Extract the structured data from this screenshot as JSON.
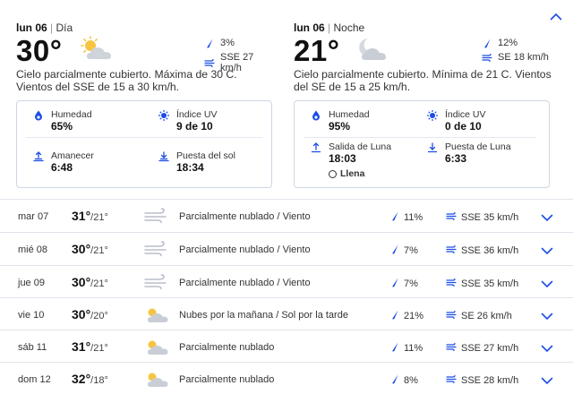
{
  "day": {
    "date": "lun 06",
    "period": "Día",
    "temp": "30°",
    "precip": "3%",
    "wind": "SSE 27 km/h",
    "description": "Cielo parcialmente cubierto. Máxima de 30 C. Vientos del SSE de 15 a 30 km/h.",
    "details": {
      "humidity_label": "Humedad",
      "humidity": "65%",
      "uv_label": "Índice UV",
      "uv": "9 de 10",
      "sunrise_label": "Amanecer",
      "sunrise": "6:48",
      "sunset_label": "Puesta del sol",
      "sunset": "18:34"
    }
  },
  "night": {
    "date": "lun 06",
    "period": "Noche",
    "temp": "21°",
    "precip": "12%",
    "wind": "SE 18 km/h",
    "description": "Cielo parcialmente cubierto. Mínima de 21 C. Vientos del SE de 15 a 25 km/h.",
    "details": {
      "humidity_label": "Humedad",
      "humidity": "95%",
      "uv_label": "Índice UV",
      "uv": "0 de 10",
      "moonrise_label": "Salida de Luna",
      "moonrise": "18:03",
      "moonset_label": "Puesta de Luna",
      "moonset": "6:33",
      "moon_phase": "Llena"
    }
  },
  "forecast": [
    {
      "date": "mar 07",
      "high": "31°",
      "low": "/21°",
      "icon": "wind-icon",
      "condition": "Parcialmente nublado / Viento",
      "precip": "11%",
      "wind": "SSE 35 km/h"
    },
    {
      "date": "mié 08",
      "high": "30°",
      "low": "/21°",
      "icon": "wind-icon",
      "condition": "Parcialmente nublado / Viento",
      "precip": "7%",
      "wind": "SSE 36 km/h"
    },
    {
      "date": "jue 09",
      "high": "30°",
      "low": "/21°",
      "icon": "wind-icon",
      "condition": "Parcialmente nublado / Viento",
      "precip": "7%",
      "wind": "SSE 35 km/h"
    },
    {
      "date": "vie 10",
      "high": "30°",
      "low": "/20°",
      "icon": "partly-cloudy-icon",
      "condition": "Nubes por la mañana / Sol por la tarde",
      "precip": "21%",
      "wind": "SE 26 km/h"
    },
    {
      "date": "sáb 11",
      "high": "31°",
      "low": "/21°",
      "icon": "partly-cloudy-icon",
      "condition": "Parcialmente nublado",
      "precip": "11%",
      "wind": "SSE 27 km/h"
    },
    {
      "date": "dom 12",
      "high": "32°",
      "low": "/18°",
      "icon": "partly-cloudy-icon",
      "condition": "Parcialmente nublado",
      "precip": "8%",
      "wind": "SSE 28 km/h"
    }
  ],
  "colors": {
    "accent": "#1b4de4",
    "text": "#1f1f1f",
    "border": "#dfe3ea",
    "cloud": "#c9ced6",
    "sun": "#f5c542"
  }
}
